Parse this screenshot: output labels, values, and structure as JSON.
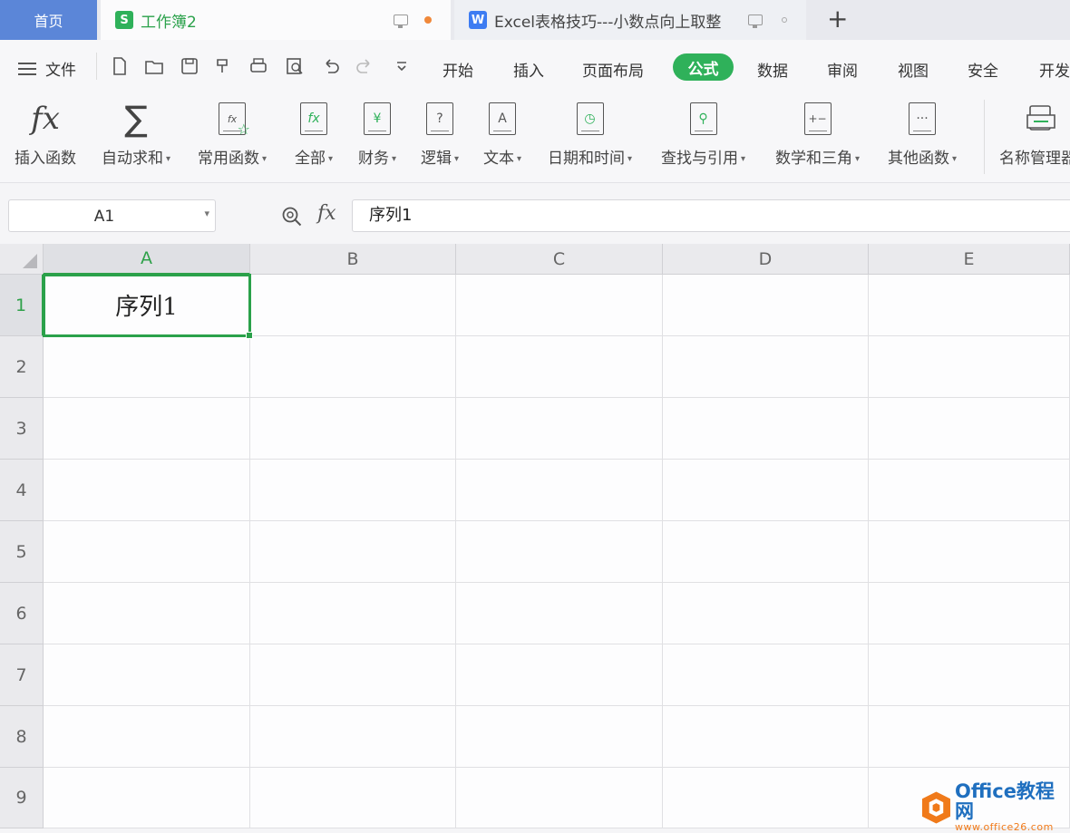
{
  "tabs": {
    "home": "首页",
    "sheet": {
      "badge": "S",
      "title": "工作簿2"
    },
    "doc": {
      "badge": "W",
      "title": "Excel表格技巧---小数点向上取整"
    },
    "new_tab": "+"
  },
  "menu": {
    "file": "文件",
    "items": [
      "开始",
      "插入",
      "页面布局",
      "公式",
      "数据",
      "审阅",
      "视图",
      "安全",
      "开发"
    ],
    "active": "公式"
  },
  "ribbon": {
    "buttons": [
      {
        "label": "插入函数",
        "icon": "fx-icon",
        "dropdown": false
      },
      {
        "label": "自动求和",
        "icon": "sigma-icon",
        "dropdown": true
      },
      {
        "label": "常用函数",
        "icon": "common-functions-icon",
        "dropdown": true
      },
      {
        "label": "全部",
        "icon": "all-functions-icon",
        "dropdown": true
      },
      {
        "label": "财务",
        "icon": "finance-icon",
        "dropdown": true
      },
      {
        "label": "逻辑",
        "icon": "logic-icon",
        "dropdown": true
      },
      {
        "label": "文本",
        "icon": "text-icon",
        "dropdown": true
      },
      {
        "label": "日期和时间",
        "icon": "date-time-icon",
        "dropdown": true
      },
      {
        "label": "查找与引用",
        "icon": "lookup-icon",
        "dropdown": true
      },
      {
        "label": "数学和三角",
        "icon": "math-trig-icon",
        "dropdown": true
      },
      {
        "label": "其他函数",
        "icon": "more-functions-icon",
        "dropdown": true
      },
      {
        "label": "名称管理器",
        "icon": "name-manager-icon",
        "dropdown": false
      }
    ]
  },
  "formula_bar": {
    "name_box": "A1",
    "fx_label": "fx",
    "content": "序列1"
  },
  "grid": {
    "columns": [
      "A",
      "B",
      "C",
      "D",
      "E"
    ],
    "rows": [
      "1",
      "2",
      "3",
      "4",
      "5",
      "6",
      "7",
      "8",
      "9"
    ],
    "active_cell": "A1",
    "cells": {
      "A1": "序列1"
    }
  },
  "watermark": {
    "title": "Office教程网",
    "url": "www.office26.com"
  },
  "colors": {
    "accent": "#2fb15a",
    "home_tab": "#5b86d8",
    "selection": "#2aa14a"
  }
}
